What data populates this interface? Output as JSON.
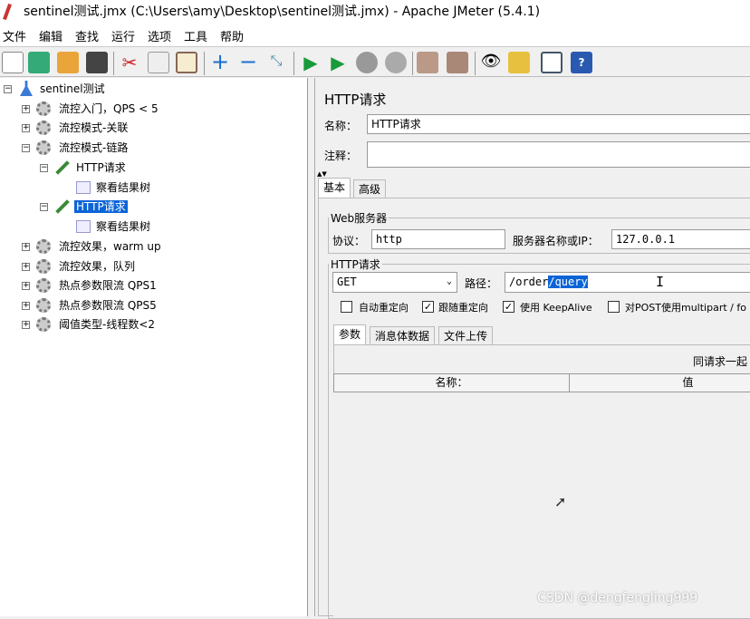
{
  "window": {
    "title": "sentinel测试.jmx (C:\\Users\\amy\\Desktop\\sentinel测试.jmx) - Apache JMeter (5.4.1)"
  },
  "menu": [
    "文件",
    "编辑",
    "查找",
    "运行",
    "选项",
    "工具",
    "帮助"
  ],
  "toolbar": [
    "new-icon",
    "templates-icon",
    "open-icon",
    "save-icon",
    "cut-icon",
    "copy-icon",
    "paste-icon",
    "expand-icon",
    "collapse-icon",
    "toggle-icon",
    "start-icon",
    "start-no-pause-icon",
    "stop-icon",
    "shutdown-icon",
    "clear-icon",
    "clear-all-icon",
    "search-icon",
    "reset-search-icon",
    "function-helper-icon",
    "help-icon"
  ],
  "tree": {
    "root": "sentinel测试",
    "items": [
      "流控入门，QPS < 5",
      "流控模式-关联",
      "流控模式-链路",
      "HTTP请求",
      "察看结果树",
      "HTTP请求",
      "察看结果树",
      "流控效果，warm up",
      "流控效果，队列",
      "热点参数限流 QPS1",
      "热点参数限流 QPS5",
      "阈值类型-线程数<2"
    ]
  },
  "panel": {
    "title": "HTTP请求",
    "name_label": "名称：",
    "name_value": "HTTP请求",
    "comment_label": "注释：",
    "comment_value": "",
    "tabs": [
      "基本",
      "高级"
    ],
    "web_server": {
      "legend": "Web服务器",
      "protocol_label": "协议：",
      "protocol_value": "http",
      "server_label": "服务器名称或IP：",
      "server_value": "127.0.0.1"
    },
    "http_request": {
      "legend": "HTTP请求",
      "method": "GET",
      "path_label": "路径：",
      "path_value": "/order",
      "path_selected": "/query",
      "checkboxes": [
        {
          "label": "自动重定向",
          "checked": false
        },
        {
          "label": "跟随重定向",
          "checked": true
        },
        {
          "label": "使用 KeepAlive",
          "checked": true
        },
        {
          "label": "对POST使用multipart / fo",
          "checked": false
        }
      ]
    },
    "sub_tabs": [
      "参数",
      "消息体数据",
      "文件上传"
    ],
    "send_with": "同请求一起",
    "columns": [
      "名称：",
      "值"
    ]
  },
  "watermark": "CSDN @dengfengling999"
}
